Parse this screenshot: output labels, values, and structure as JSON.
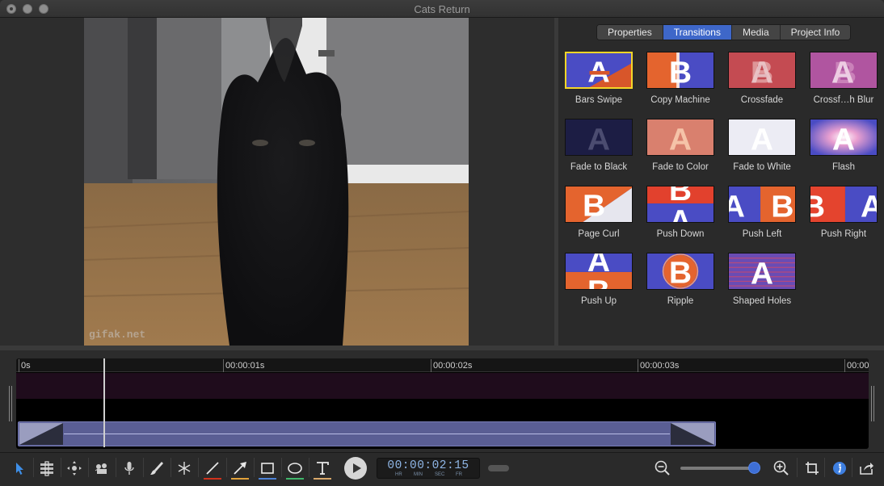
{
  "window": {
    "title": "Cats Return"
  },
  "preview": {
    "watermark": "gifak.net"
  },
  "panel": {
    "tabs": [
      {
        "label": "Properties",
        "active": false
      },
      {
        "label": "Transitions",
        "active": true
      },
      {
        "label": "Media",
        "active": false
      },
      {
        "label": "Project Info",
        "active": false
      }
    ],
    "transitions": [
      {
        "label": "Bars Swipe",
        "icon": "bars-swipe-thumbnail",
        "selected": true
      },
      {
        "label": "Copy Machine",
        "icon": "copy-machine-thumbnail"
      },
      {
        "label": "Crossfade",
        "icon": "crossfade-thumbnail"
      },
      {
        "label": "Crossf…h Blur",
        "icon": "crossfade-blur-thumbnail"
      },
      {
        "label": "Fade to Black",
        "icon": "fade-to-black-thumbnail"
      },
      {
        "label": "Fade to Color",
        "icon": "fade-to-color-thumbnail"
      },
      {
        "label": "Fade to White",
        "icon": "fade-to-white-thumbnail"
      },
      {
        "label": "Flash",
        "icon": "flash-thumbnail"
      },
      {
        "label": "Page Curl",
        "icon": "page-curl-thumbnail"
      },
      {
        "label": "Push Down",
        "icon": "push-down-thumbnail"
      },
      {
        "label": "Push Left",
        "icon": "push-left-thumbnail"
      },
      {
        "label": "Push Right",
        "icon": "push-right-thumbnail"
      },
      {
        "label": "Push Up",
        "icon": "push-up-thumbnail"
      },
      {
        "label": "Ripple",
        "icon": "ripple-thumbnail"
      },
      {
        "label": "Shaped Holes",
        "icon": "shaped-holes-thumbnail"
      }
    ],
    "thumb_letters": [
      "A",
      "B"
    ]
  },
  "timeline": {
    "ruler": [
      "0s",
      "00:00:01s",
      "00:00:02s",
      "00:00:03s",
      "00:00"
    ]
  },
  "toolbar": {
    "tools": [
      {
        "name": "pointer-tool-icon"
      },
      {
        "name": "trim-tool-icon"
      },
      {
        "name": "pan-zoom-tool-icon"
      },
      {
        "name": "smart-focus-tool-icon"
      },
      {
        "name": "microphone-icon"
      },
      {
        "name": "highlight-brush-icon"
      },
      {
        "name": "freeze-frame-icon"
      },
      {
        "name": "line-tool-icon",
        "color": "#d0321c"
      },
      {
        "name": "arrow-tool-icon",
        "color": "#e2a23a"
      },
      {
        "name": "rectangle-tool-icon",
        "color": "#4c82d6"
      },
      {
        "name": "ellipse-tool-icon",
        "color": "#3fb66a"
      },
      {
        "name": "text-tool-icon",
        "color": "#d9a86a"
      }
    ],
    "timecode": "00:00:02:15",
    "timecode_units": [
      "HR",
      "MIN",
      "SEC",
      "FR"
    ],
    "accent": "#3e6fd6"
  }
}
